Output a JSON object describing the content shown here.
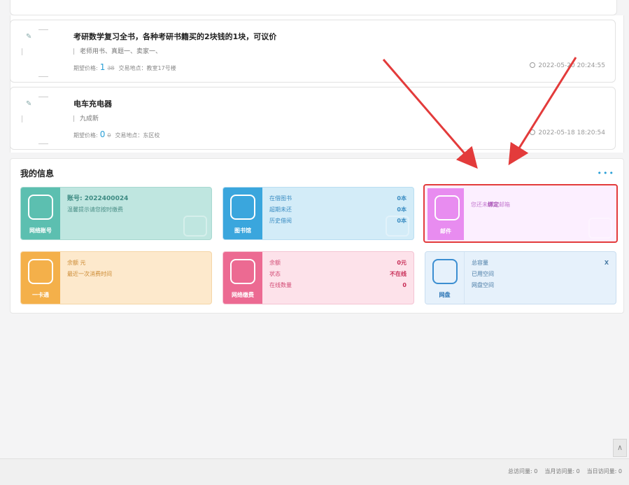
{
  "listings": [
    {
      "title": "考研数学复习全书，各种考研书籍买的2块钱的1块，可议价",
      "subtitle": "老师用书、真题一、卖家一、",
      "price_label": "期望价格:",
      "price": "1",
      "original_price": "38",
      "trade_location": "交易地点：教室17号楼",
      "time": "2022-05-20 20:24:55"
    },
    {
      "title": "电车充电器",
      "subtitle": "九成新",
      "price_label": "期望价格:",
      "price": "0",
      "original_price": "0",
      "trade_location": "交易地点：东区校",
      "time": "2022-05-18 18:20:54"
    }
  ],
  "my_info": {
    "title": "我的信息",
    "more": "•••",
    "tiles": {
      "network_account": {
        "caption": "网络账号",
        "account_label": "账号: 2022400024",
        "note": "温馨提示请您按时缴费"
      },
      "library": {
        "caption": "图书馆",
        "rows": [
          {
            "label": "在借图书",
            "value": "0本"
          },
          {
            "label": "超期未还",
            "value": "0本"
          },
          {
            "label": "历史借阅",
            "value": "0本"
          }
        ]
      },
      "mail": {
        "caption": "邮件",
        "prefix": "您还未",
        "highlight": "绑定",
        "suffix": "邮箱"
      },
      "campus_card": {
        "caption": "一卡通",
        "balance": "余额 元",
        "last_time": "最近一次消费时间"
      },
      "network_fee": {
        "caption": "网络缴费",
        "rows": [
          {
            "label": "余额",
            "value": "0元"
          },
          {
            "label": "状态",
            "value": "不在线"
          },
          {
            "label": "在线数量",
            "value": "0"
          }
        ]
      },
      "cloud_disk": {
        "caption": "网盘",
        "total": "总容量",
        "used": "已用空间",
        "free": "网盘空间",
        "close": "X"
      }
    }
  },
  "footer": {
    "stats": [
      "总访问量: 0",
      "当月访问量: 0",
      "当日访问量: 0"
    ]
  },
  "scroll_top_label": "∧",
  "colors": {
    "highlight_border": "#e33b3b",
    "arrow": "#e33b3b"
  }
}
